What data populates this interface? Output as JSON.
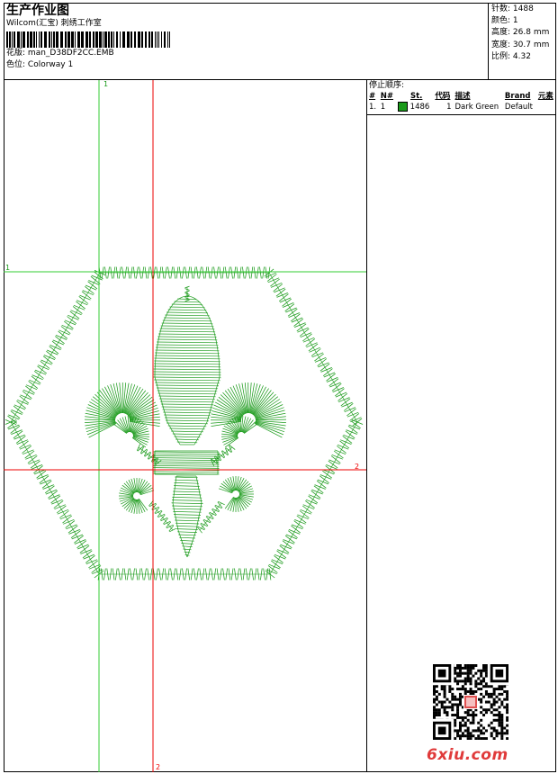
{
  "header": {
    "title": "生产作业图",
    "studio": "Wilcom(汇宝) 刺绣工作室",
    "design_label": "花版:",
    "design_name": "man_D38DF2CC.EMB",
    "colorway_label": "色位:",
    "colorway_name": "Colorway 1"
  },
  "stats": [
    {
      "label": "针数:",
      "value": "1488"
    },
    {
      "label": "颜色:",
      "value": "1"
    },
    {
      "label": "高度:",
      "value": "26.8 mm"
    },
    {
      "label": "宽度:",
      "value": "30.7 mm"
    },
    {
      "label": "比例:",
      "value": "4.32"
    }
  ],
  "sequence": {
    "title": "停止顺序:",
    "columns": [
      "#",
      "N#",
      "St.",
      "代码",
      "描述",
      "Brand",
      "元素"
    ],
    "rows": [
      {
        "num": "1.",
        "n": "1",
        "stitches": "1486",
        "code": "1",
        "desc": "Dark Green",
        "brand": "Default",
        "color": "#1a9a1a"
      }
    ]
  },
  "guides": {
    "green_v": "1",
    "green_h": "1",
    "red_h": "2",
    "red_v": "2"
  },
  "colors": {
    "thread": "#1a9a1a",
    "guide_green": "#33cc33",
    "guide_red": "#ee0000"
  },
  "watermark": "6xiu.com"
}
